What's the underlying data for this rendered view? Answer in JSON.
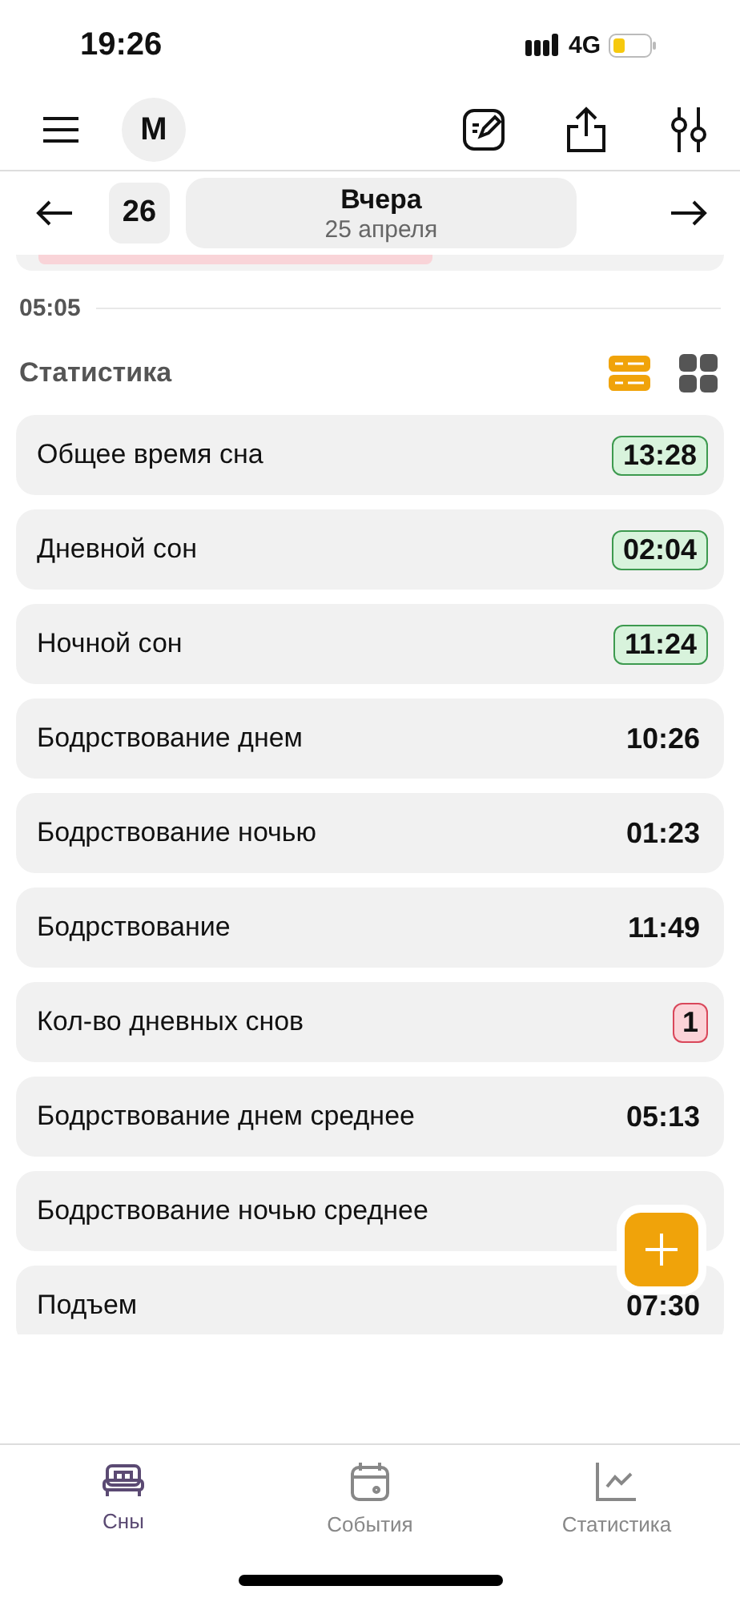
{
  "status_bar": {
    "time": "19:26",
    "network": "4G"
  },
  "header": {
    "avatar": "M"
  },
  "date_nav": {
    "day": "26",
    "title": "Вчера",
    "subtitle": "25 апреля"
  },
  "timeline": {
    "time": "05:05"
  },
  "stats": {
    "title": "Статистика",
    "view_toggle": [
      {
        "kind": "list",
        "selected": true
      },
      {
        "kind": "grid",
        "selected": false
      }
    ],
    "rows": [
      {
        "label": "Общее время сна",
        "value": "13:28",
        "kind": "positive"
      },
      {
        "label": "Дневной сон",
        "value": "02:04",
        "kind": "positive"
      },
      {
        "label": "Ночной сон",
        "value": "11:24",
        "kind": "positive"
      },
      {
        "label": "Бодрствование днем",
        "value": "10:26",
        "kind": "plain"
      },
      {
        "label": "Бодрствование ночью",
        "value": "01:23",
        "kind": "plain"
      },
      {
        "label": "Бодрствование",
        "value": "11:49",
        "kind": "plain"
      },
      {
        "label": "Кол-во дневных снов",
        "value": "1",
        "kind": "negative"
      },
      {
        "label": "Бодрствование днем среднее",
        "value": "05:13",
        "kind": "plain"
      },
      {
        "label": "Бодрствование ночью среднее"
      },
      {
        "label": "Подъем",
        "value": "07:30",
        "kind": "plain"
      }
    ]
  },
  "bottom_tabs": [
    {
      "kind": "bed",
      "label": "Сны",
      "selected": true
    },
    {
      "kind": "calendar",
      "label": "События",
      "selected": false
    },
    {
      "kind": "chart",
      "label": "Статистика",
      "selected": false
    }
  ]
}
